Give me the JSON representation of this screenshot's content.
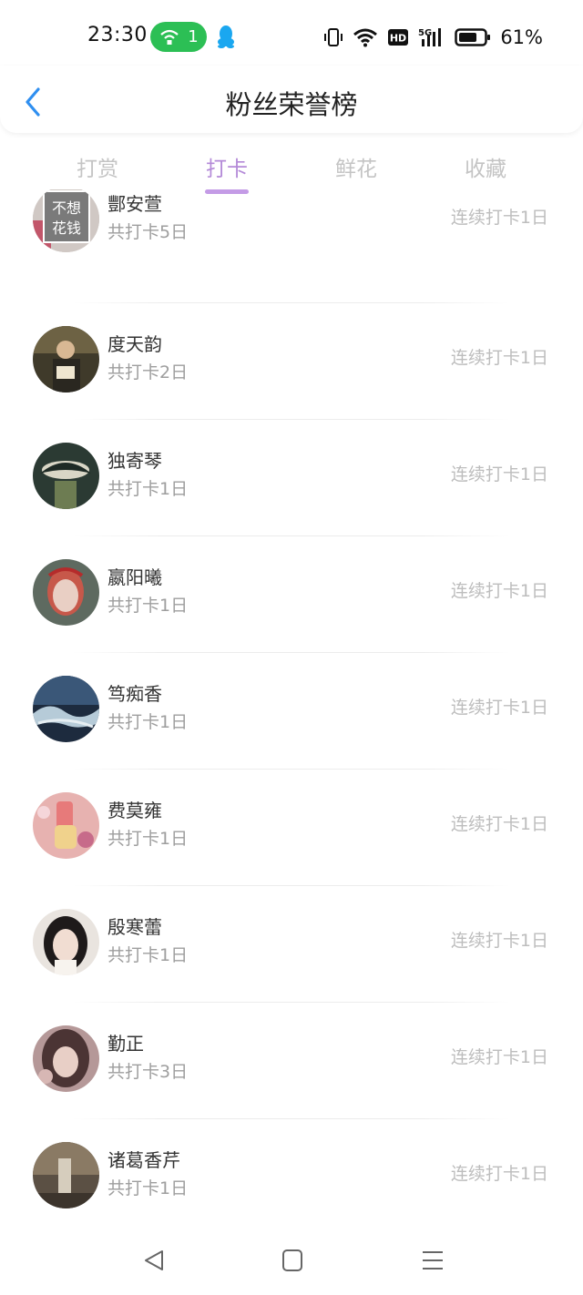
{
  "status_bar": {
    "time": "23:30",
    "hotspot_count": "1",
    "battery_percent": "61%",
    "icons": [
      "hotspot-icon",
      "qq-icon",
      "vibrate-icon",
      "wifi-icon",
      "hd-icon",
      "signal-5g-icon",
      "battery-icon"
    ]
  },
  "header": {
    "title": "粉丝荣誉榜",
    "back_icon": "chevron-left-icon",
    "accent_color": "#2f8ff0"
  },
  "tabs": [
    {
      "label": "打赏",
      "active": false
    },
    {
      "label": "打卡",
      "active": true
    },
    {
      "label": "鲜花",
      "active": false
    },
    {
      "label": "收藏",
      "active": false
    }
  ],
  "tab_active_color": "#b48ad8",
  "list": [
    {
      "name": "酆安萱",
      "total": "共打卡5日",
      "streak": "连续打卡1日",
      "avatar_text": "不想花钱"
    },
    {
      "name": "度天韵",
      "total": "共打卡2日",
      "streak": "连续打卡1日"
    },
    {
      "name": "独寄琴",
      "total": "共打卡1日",
      "streak": "连续打卡1日"
    },
    {
      "name": "嬴阳曦",
      "total": "共打卡1日",
      "streak": "连续打卡1日"
    },
    {
      "name": "笃痴香",
      "total": "共打卡1日",
      "streak": "连续打卡1日"
    },
    {
      "name": "费莫雍",
      "total": "共打卡1日",
      "streak": "连续打卡1日"
    },
    {
      "name": "殷寒蕾",
      "total": "共打卡1日",
      "streak": "连续打卡1日"
    },
    {
      "name": "勤正",
      "total": "共打卡3日",
      "streak": "连续打卡1日"
    },
    {
      "name": "诸葛香芹",
      "total": "共打卡1日",
      "streak": "连续打卡1日"
    }
  ],
  "nav_bar": {
    "icons": [
      "back-triangle-icon",
      "home-square-icon",
      "menu-lines-icon"
    ]
  }
}
